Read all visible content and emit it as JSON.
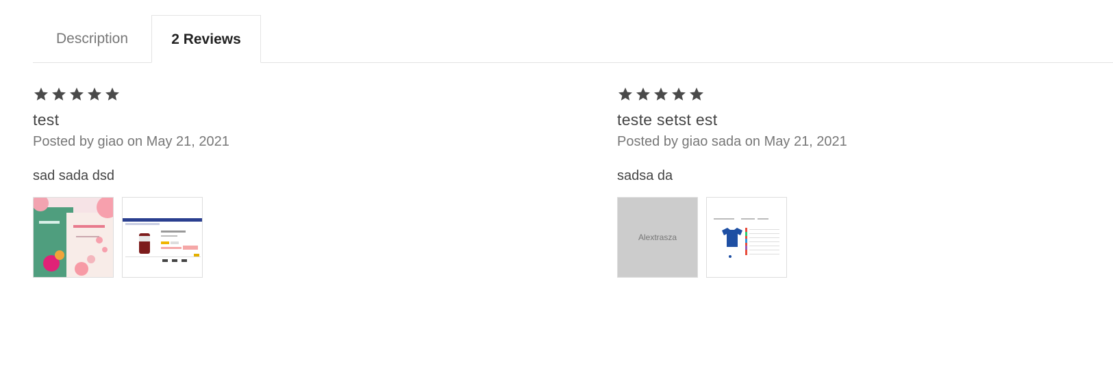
{
  "tabs": [
    {
      "label": "Description"
    },
    {
      "label": "2 Reviews"
    }
  ],
  "reviews": [
    {
      "rating": 5,
      "title": "test",
      "meta": "Posted by giao on May 21, 2021",
      "body": "sad sada dsd",
      "images": [
        {
          "kind": "book-cover-photo"
        },
        {
          "kind": "product-page-screenshot"
        }
      ]
    },
    {
      "rating": 5,
      "title": "teste setst est",
      "meta": "Posted by giao sada on May 21, 2021",
      "body": "sadsa da",
      "images": [
        {
          "kind": "placeholder",
          "text": "Alextrasza"
        },
        {
          "kind": "tshirt-product-screenshot"
        }
      ]
    }
  ],
  "colors": {
    "star": "#4a4a4a",
    "border": "#e3e3e3",
    "muted_text": "#777777",
    "placeholder_bg": "#cccccc"
  }
}
